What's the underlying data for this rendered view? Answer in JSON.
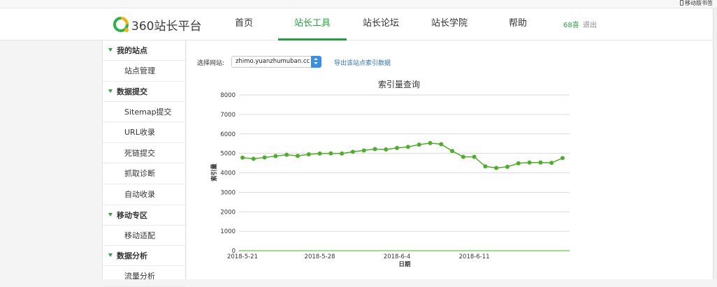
{
  "top_bar": {
    "mobile_label": "移动版书签"
  },
  "header": {
    "logo_text": "360站长平台",
    "nav": [
      "首页",
      "站长工具",
      "站长论坛",
      "站长学院",
      "帮助"
    ],
    "active_nav": 1,
    "user_name": "68喜",
    "logout_label": "退出"
  },
  "sidebar": {
    "groups": [
      {
        "label": "我的站点",
        "items": [
          "站点管理"
        ]
      },
      {
        "label": "数据提交",
        "items": [
          "Sitemap提交",
          "URL收录",
          "死链提交",
          "抓取诊断",
          "自动收录"
        ]
      },
      {
        "label": "移动专区",
        "items": [
          "移动适配"
        ]
      },
      {
        "label": "数据分析",
        "items": [
          "流量分析"
        ]
      }
    ]
  },
  "toolbar": {
    "site_label": "选择网站:",
    "site_value": "zhimo.yuanzhumuban.cc",
    "export_link": "导出该站点索引数据"
  },
  "colors": {
    "accent": "#23a83c",
    "link": "#2673c8",
    "line": "#4caf28"
  },
  "chart_data": {
    "type": "line",
    "title": "索引量查询",
    "xlabel": "日期",
    "ylabel": "索引量",
    "ylim": [
      0,
      8000
    ],
    "yticks": [
      0,
      1000,
      2000,
      3000,
      4000,
      5000,
      6000,
      7000,
      8000
    ],
    "x_tick_labels": [
      {
        "index": 0,
        "label": "2018-5-21"
      },
      {
        "index": 7,
        "label": "2018-5-28"
      },
      {
        "index": 14,
        "label": "2018-6-4"
      },
      {
        "index": 21,
        "label": "2018-6-11"
      }
    ],
    "grid": true,
    "series": [
      {
        "values": [
          4780,
          4720,
          4790,
          4860,
          4930,
          4870,
          4950,
          4990,
          5000,
          4990,
          5080,
          5150,
          5220,
          5200,
          5280,
          5330,
          5450,
          5530,
          5470,
          5120,
          4820,
          4820,
          4330,
          4250,
          4310,
          4490,
          4530,
          4530,
          4510,
          4760
        ]
      }
    ]
  }
}
